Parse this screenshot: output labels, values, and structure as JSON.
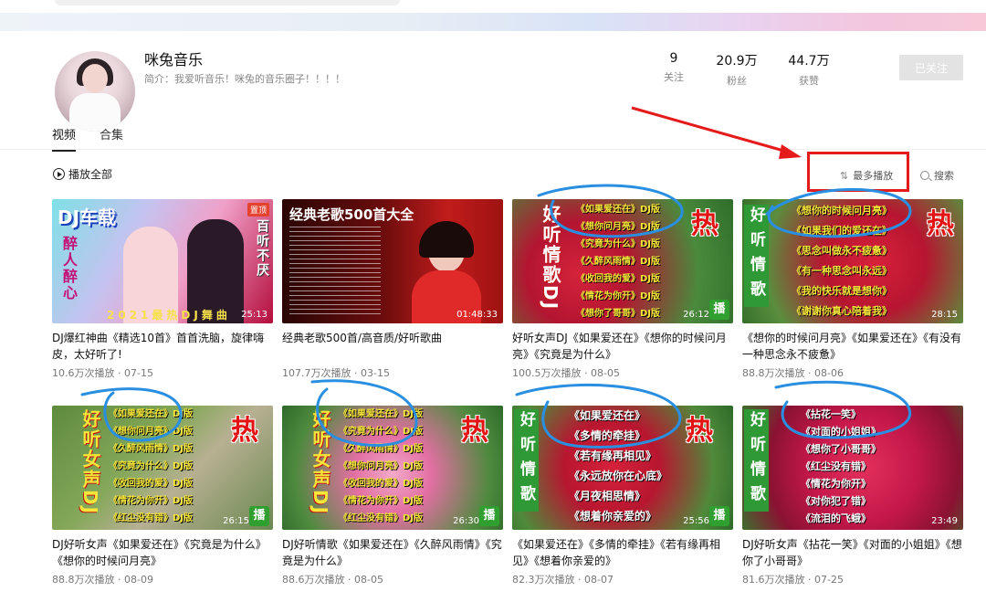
{
  "colors": {
    "accent_red": "#e51b1b",
    "scribble_blue": "#2a8fe0",
    "follow_bg": "#e3e3e3"
  },
  "profile": {
    "name": "咪兔音乐",
    "bio": "简介：我爱听音乐！咪兔的音乐圈子！！！！",
    "stats": [
      {
        "num": "9",
        "label": "关注"
      },
      {
        "num": "20.9万",
        "label": "粉丝"
      },
      {
        "num": "44.7万",
        "label": "获赞"
      }
    ],
    "follow_label": "已关注"
  },
  "tabs": {
    "videos": "视频",
    "collections": "合集"
  },
  "toolbar": {
    "play_all": "播放全部",
    "sort": "最多播放",
    "search": "搜索"
  },
  "videos": [
    {
      "title": "DJ爆红神曲《精选10首》首首洗脑，旋律嗨皮，太好听了!",
      "meta": "10.6万次播放 · 07-15",
      "duration": "25:13",
      "badge": "置顶",
      "thumb_head": "DJ车载",
      "thumb_left": "醉人醉心",
      "thumb_right": "百听不厌",
      "thumb_bottom": "2021最热DJ舞曲"
    },
    {
      "title": "经典老歌500首/高音质/好听歌曲",
      "meta": "107.7万次播放 · 03-15",
      "duration": "01:48:33",
      "thumb_head": "经典老歌500首大全"
    },
    {
      "title": "好听女声DJ《如果爱还在》《想你的时候问月亮》《究竟是为什么》",
      "meta": "100.5万次播放 · 08-05",
      "duration": "26:12",
      "thumb_vert": "好听情歌DJ",
      "hot": "热",
      "bo": "播",
      "songs": [
        "《如果爱还在》DJ版",
        "《想你问月亮》DJ版",
        "《究竟为什么》DJ版",
        "《久醉风雨情》DJ版",
        "《收回我的爱》DJ版",
        "《情花为你开》DJ版",
        "《想你了哥哥》DJ版"
      ]
    },
    {
      "title": "《想你的时候问月亮》《如果爱还在》《有没有一种思念永不疲惫》",
      "meta": "88.8万次播放 · 08-06",
      "duration": "28:15",
      "thumb_vert": "好听情歌",
      "hot": "热",
      "songs": [
        "《想你的时候问月亮》",
        "《如果我们的爱还在》",
        "《思念叫做永不疲惫》",
        "《有一种思念叫永远》",
        "《我的快乐就是想你》",
        "《谢谢你真心陪着我》"
      ]
    },
    {
      "title": "DJ好听女声《如果爱还在》《究竟是为什么》《想你的时候问月亮》",
      "meta": "88.8万次播放 · 08-09",
      "duration": "26:15",
      "thumb_vert": "好听女声DJ",
      "hot": "热",
      "bo": "播",
      "songs": [
        "《如果爱还在》DJ版",
        "《想你问月亮》DJ版",
        "《久醉风雨情》DJ版",
        "《究竟为什么》DJ版",
        "《收回我的爱》DJ版",
        "《情花为你开》DJ版",
        "《红尘没有错》DJ版"
      ]
    },
    {
      "title": "DJ好听情歌《如果爱还在》《久醉风雨情》《究竟是为什么》",
      "meta": "88.6万次播放 · 08-05",
      "duration": "26:30",
      "thumb_vert": "好听女声DJ",
      "hot": "热",
      "bo": "播",
      "songs": [
        "《如果爱还在》DJ版",
        "《究竟为什么》DJ版",
        "《久醉风雨情》DJ版",
        "《想你问月亮》DJ版",
        "《收回我的爱》DJ版",
        "《情花为你开》DJ版",
        "《红尘没有错》DJ版"
      ]
    },
    {
      "title": "《如果爱还在》《多情的牵挂》《若有缘再相见》《想着你亲爱的》",
      "meta": "82.3万次播放 · 08-07",
      "duration": "25:56",
      "thumb_vert": "好听情歌",
      "hot": "热",
      "bo": "播",
      "songs": [
        "《如果爱还在》",
        "《多情的牵挂》",
        "《若有缘再相见》",
        "《永远放你在心底》",
        "《月夜相思情》",
        "《想着你亲爱的》"
      ]
    },
    {
      "title": "DJ好听女声《拈花一笑》《对面的小姐姐》《想你了小哥哥》",
      "meta": "81.6万次播放 · 07-25",
      "duration": "23:49",
      "thumb_vert": "好听情歌",
      "songs": [
        "《拈花一笑》",
        "《对面的小姐姐》",
        "《想你了小哥哥》",
        "《红尘没有错》",
        "《情花为你开》",
        "《对你犯了错》",
        "《流泪的飞蛾》"
      ]
    }
  ]
}
